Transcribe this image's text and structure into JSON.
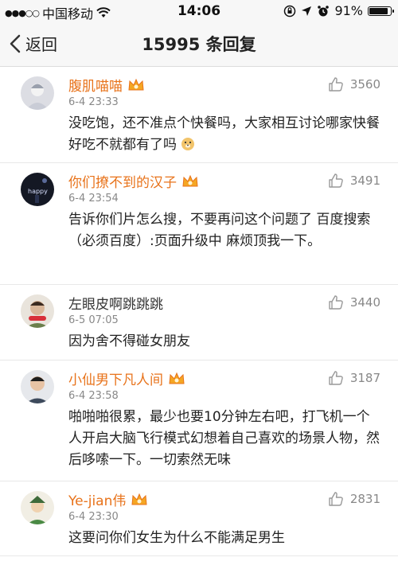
{
  "status": {
    "carrier": "中国移动",
    "time": "14:06",
    "battery": "91%",
    "battery_level": 0.91
  },
  "nav": {
    "back_label": "返回",
    "title": "15995 条回复"
  },
  "comments": [
    {
      "name": "腹肌喵喵",
      "vip": true,
      "date": "6-4 23:33",
      "likes": "3560",
      "text": "没吃饱，还不准点个快餐吗，大家相互讨论哪家快餐好吃不就都有了吗"
    },
    {
      "name": "你们撩不到的汉子",
      "vip": true,
      "date": "6-4 23:54",
      "likes": "3491",
      "text": "告诉你们片怎么搜，不要再问这个问题了 百度搜索（必须百度）:页面升级中 麻烦顶我一下。"
    },
    {
      "name": "左眼皮啊跳跳跳",
      "vip": false,
      "date": "6-5 07:05",
      "likes": "3440",
      "text": "因为舍不得碰女朋友"
    },
    {
      "name": "小仙男下凡人间",
      "vip": true,
      "date": "6-4 23:58",
      "likes": "3187",
      "text": "啪啪啪很累，最少也要10分钟左右吧，打飞机一个人开启大脑飞行模式幻想着自己喜欢的场景人物，然后哆嗦一下。一切索然无味"
    },
    {
      "name": "Ye-jian伟",
      "vip": true,
      "date": "6-4 23:30",
      "likes": "2831",
      "text": "这要问你们女生为什么不能满足男生"
    }
  ]
}
